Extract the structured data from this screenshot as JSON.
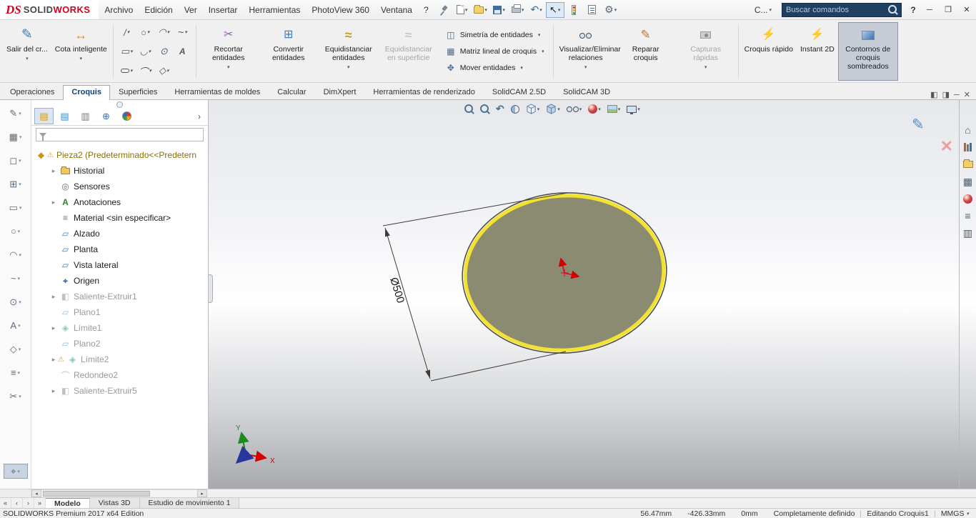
{
  "titlebar": {
    "logo_ds": "DS",
    "logo_part1": "SOLID",
    "logo_part2": "WORKS",
    "menus": [
      "Archivo",
      "Edición",
      "Ver",
      "Insertar",
      "Herramientas",
      "PhotoView 360",
      "Ventana",
      "?"
    ],
    "collapsed_label": "C...",
    "search_placeholder": "Buscar comandos",
    "help_label": "?"
  },
  "ribbon": {
    "exit_sketch": "Salir del cr...",
    "smart_dimension": "Cota inteligente",
    "trim": "Recortar entidades",
    "convert": "Convertir entidades",
    "offset": "Equidistanciar entidades",
    "offset_surface": "Equidistanciar en superficie",
    "mirror": "Simetría de entidades",
    "linear_pattern": "Matriz lineal de croquis",
    "move": "Mover entidades",
    "relations": "Visualizar/Eliminar relaciones",
    "repair": "Reparar croquis",
    "snapshots": "Capturas rápidas",
    "rapid": "Croquis rápido",
    "instant2d": "Instant 2D",
    "shaded_contours": "Contornos de croquis sombreados"
  },
  "ribbon_tabs": {
    "items": [
      "Operaciones",
      "Croquis",
      "Superficies",
      "Herramientas de moldes",
      "Calcular",
      "DimXpert",
      "Herramientas de renderizado",
      "SolidCAM 2.5D",
      "SolidCAM 3D"
    ],
    "active": "Croquis"
  },
  "tree": {
    "root": "Pieza2 (Predeterminado<<Predetern",
    "items": [
      "Historial",
      "Sensores",
      "Anotaciones",
      "Material <sin especificar>",
      "Alzado",
      "Planta",
      "Vista lateral",
      "Origen",
      "Saliente-Extruir1",
      "Plano1",
      "Límite1",
      "Plano2",
      "Límite2",
      "Redondeo2",
      "Saliente-Extruir5"
    ]
  },
  "viewport": {
    "dimension": "Ø500",
    "triad_x": "X",
    "triad_y": "Y"
  },
  "doc_tabs": {
    "items": [
      "Modelo",
      "Vistas 3D",
      "Estudio de movimiento 1"
    ],
    "active": "Modelo"
  },
  "statusbar": {
    "product": "SOLIDWORKS Premium 2017 x64 Edition",
    "x": "56.47mm",
    "y": "-426.33mm",
    "z": "0mm",
    "state": "Completamente definido",
    "mode": "Editando Croquis1",
    "units": "MMGS"
  }
}
